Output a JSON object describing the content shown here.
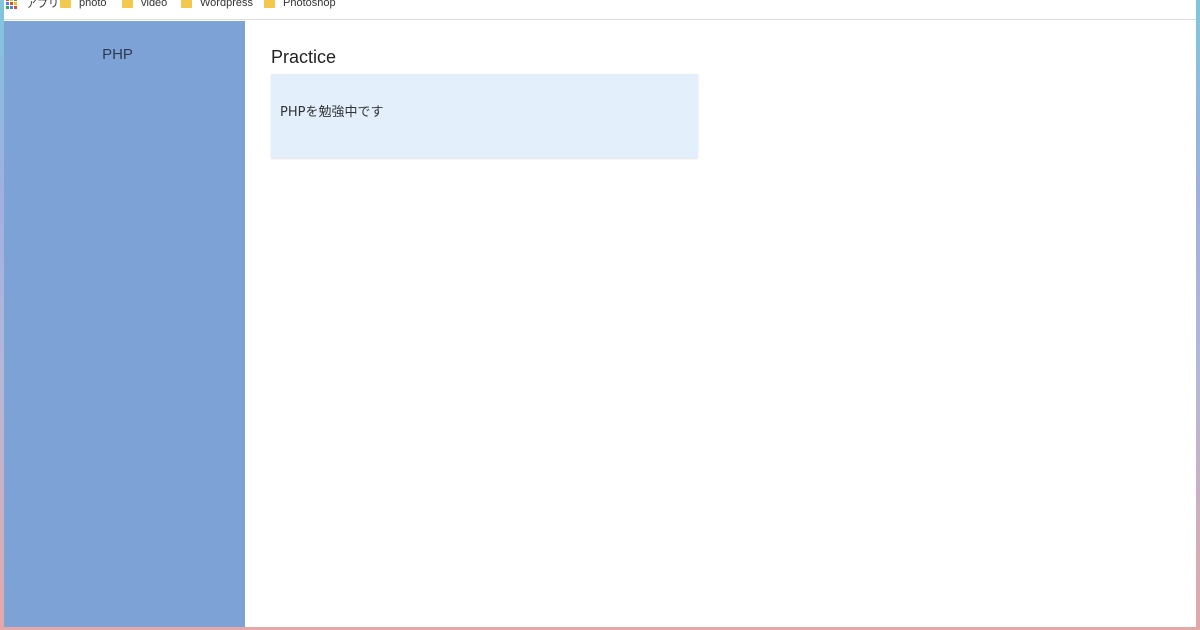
{
  "bookmarks": [
    {
      "label": "アプリ",
      "icon": "apps-grid-icon"
    },
    {
      "label": "photo",
      "icon": "folder-icon"
    },
    {
      "label": "video",
      "icon": "folder-icon"
    },
    {
      "label": "Wordpress",
      "icon": "folder-icon"
    },
    {
      "label": "Photoshop",
      "icon": "folder-icon"
    }
  ],
  "sidebar": {
    "title": "PHP"
  },
  "main": {
    "title": "Practice",
    "card_text": "PHPを勉強中です"
  },
  "colors": {
    "sidebar_bg": "#7da3d6",
    "card_bg": "#e3f0fc",
    "folder": "#f2c94c"
  }
}
